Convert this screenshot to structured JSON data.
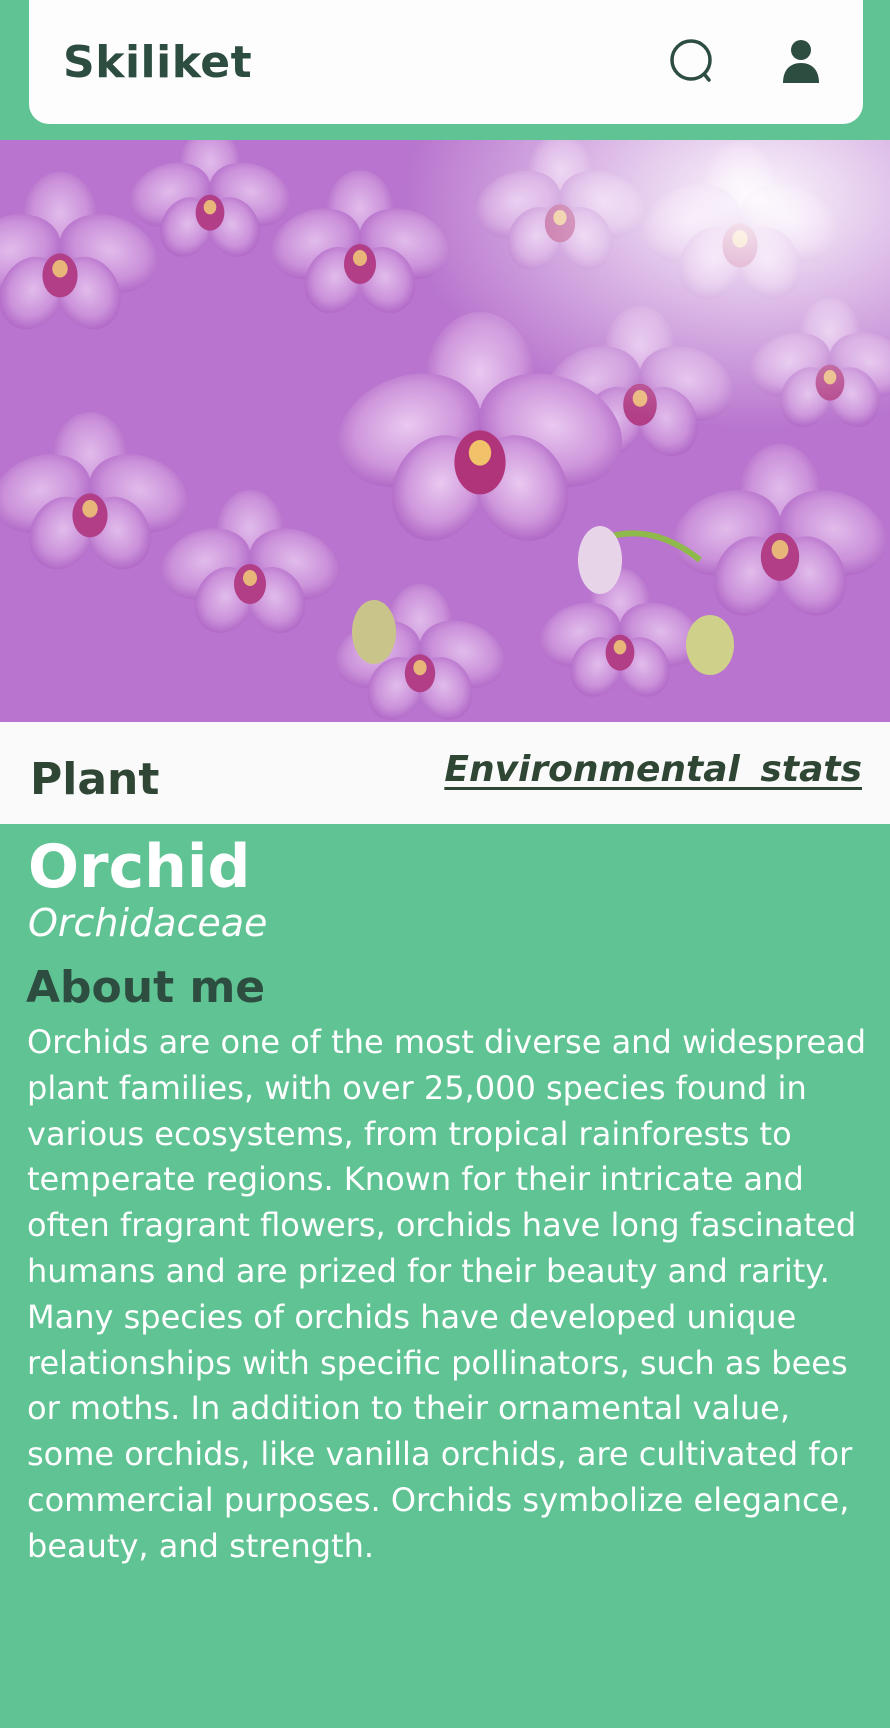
{
  "app": {
    "title": "Skiliket"
  },
  "header": {
    "search_icon": "search-icon",
    "profile_icon": "user-icon"
  },
  "hero": {
    "subject": "orchid-photo"
  },
  "section": {
    "category": "Plant",
    "link_label": "Environmental  stats"
  },
  "plant": {
    "name": "Orchid",
    "family": "Orchidaceae",
    "about_heading": "About me",
    "about_text": "Orchids are one of the most diverse and widespread plant families, with over 25,000 species found in various ecosystems, from tropical rainforests to temperate regions. Known for their intricate and often fragrant flowers, orchids have long fascinated humans and are prized for their beauty and rarity. Many species of orchids have developed unique relationships with specific pollinators, such as bees or moths. In addition to their ornamental value, some orchids, like vanilla orchids, are cultivated for commercial purposes. Orchids symbolize elegance, beauty, and strength."
  },
  "colors": {
    "background": "#5fc394",
    "brand_text": "#2d4d40",
    "header_bg": "#fdfdfd",
    "orchid_purple": "#c187d3"
  }
}
